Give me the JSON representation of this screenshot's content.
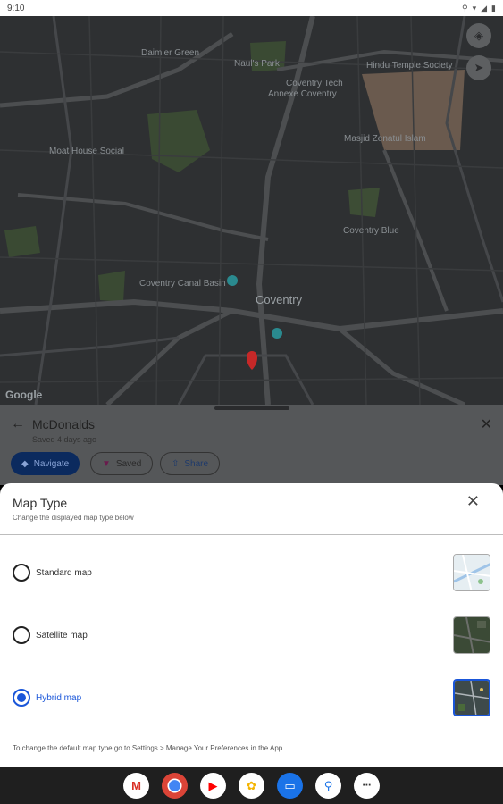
{
  "status_bar": {
    "time": "9:10",
    "icons": [
      "location-icon",
      "wifi-icon",
      "signal-icon",
      "battery-icon"
    ]
  },
  "map": {
    "labels": {
      "daimler_green": "Daimler Green",
      "naul_park": "Naul's Park",
      "coventry_tech": "Coventry Tech",
      "annexe_coventry": "Annexe Coventry",
      "hindu_temple": "Hindu Temple Society",
      "masjid": "Masjid Zenatul Islam",
      "moat_house": "Moat House Social",
      "coventry_uni": "Coventry Blue",
      "canal_basin": "Coventry Canal Basin",
      "coventry": "Coventry",
      "google": "Google"
    }
  },
  "place": {
    "title": "McDonalds",
    "subtitle": "Saved 4 days ago",
    "navigate_label": "Navigate",
    "saved_label": "Saved",
    "share_label": "Share"
  },
  "sheet": {
    "title": "Map Type",
    "subtitle": "Change the displayed map type below",
    "options": [
      {
        "label": "Standard map",
        "selected": false
      },
      {
        "label": "Satellite map",
        "selected": false
      },
      {
        "label": "Hybrid map",
        "selected": true
      }
    ],
    "footer": "To change the default map type go to Settings > Manage Your Preferences in the App"
  },
  "colors": {
    "accent": "#1a56d9",
    "navigate_pill": "#0b2a5e",
    "map_bg": "#2d2f31"
  },
  "dock": [
    "gmail-icon",
    "chrome-icon",
    "youtube-icon",
    "photos-icon",
    "messages-icon",
    "maps-app-icon",
    "app-drawer-icon"
  ]
}
